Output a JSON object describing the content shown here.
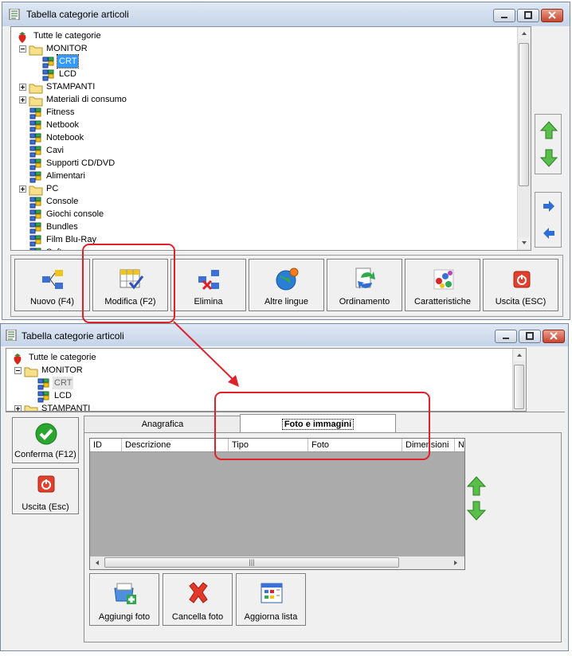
{
  "window1": {
    "title": "Tabella categorie articoli",
    "tree": [
      {
        "label": "Tutte le categorie",
        "icon": "strawberry-icon",
        "level": 0,
        "expander": ""
      },
      {
        "label": "MONITOR",
        "icon": "folder-icon",
        "level": 1,
        "expander": "-"
      },
      {
        "label": "CRT",
        "icon": "category-node-icon",
        "level": 2,
        "expander": "",
        "selected": true
      },
      {
        "label": "LCD",
        "icon": "category-node-icon",
        "level": 2,
        "expander": ""
      },
      {
        "label": "STAMPANTI",
        "icon": "folder-icon",
        "level": 1,
        "expander": "+"
      },
      {
        "label": "Materiali di consumo",
        "icon": "folder-icon",
        "level": 1,
        "expander": "+"
      },
      {
        "label": "Fitness",
        "icon": "category-node-icon",
        "level": 1,
        "expander": ""
      },
      {
        "label": "Netbook",
        "icon": "category-node-icon",
        "level": 1,
        "expander": ""
      },
      {
        "label": "Notebook",
        "icon": "category-node-icon",
        "level": 1,
        "expander": ""
      },
      {
        "label": "Cavi",
        "icon": "category-node-icon",
        "level": 1,
        "expander": ""
      },
      {
        "label": "Supporti CD/DVD",
        "icon": "category-node-icon",
        "level": 1,
        "expander": ""
      },
      {
        "label": "Alimentari",
        "icon": "category-node-icon",
        "level": 1,
        "expander": ""
      },
      {
        "label": "PC",
        "icon": "folder-icon",
        "level": 1,
        "expander": "+"
      },
      {
        "label": "Console",
        "icon": "category-node-icon",
        "level": 1,
        "expander": ""
      },
      {
        "label": "Giochi console",
        "icon": "category-node-icon",
        "level": 1,
        "expander": ""
      },
      {
        "label": "Bundles",
        "icon": "category-node-icon",
        "level": 1,
        "expander": ""
      },
      {
        "label": "Film Blu-Ray",
        "icon": "category-node-icon",
        "level": 1,
        "expander": ""
      },
      {
        "label": "Software",
        "icon": "category-node-icon",
        "level": 1,
        "expander": ""
      }
    ],
    "toolbar": [
      {
        "label": "Nuovo (F4)",
        "icon": "new-node-icon",
        "name": "nuovo-button"
      },
      {
        "label": "Modifica (F2)",
        "icon": "edit-grid-icon",
        "name": "modifica-button"
      },
      {
        "label": "Elimina",
        "icon": "delete-node-icon",
        "name": "elimina-button"
      },
      {
        "label": "Altre lingue",
        "icon": "globe-icon",
        "name": "altre-lingue-button"
      },
      {
        "label": "Ordinamento",
        "icon": "sort-icon",
        "name": "ordinamento-button"
      },
      {
        "label": "Caratteristiche",
        "icon": "features-icon",
        "name": "caratteristiche-button"
      },
      {
        "label": "Uscita (ESC)",
        "icon": "exit-icon",
        "name": "uscita-button"
      }
    ]
  },
  "window2": {
    "title": "Tabella categorie articoli",
    "tree": [
      {
        "label": "Tutte le categorie",
        "icon": "strawberry-icon",
        "level": 0,
        "expander": ""
      },
      {
        "label": "MONITOR",
        "icon": "folder-icon",
        "level": 1,
        "expander": "-"
      },
      {
        "label": "CRT",
        "icon": "category-node-icon",
        "level": 2,
        "expander": "",
        "selected": true
      },
      {
        "label": "LCD",
        "icon": "category-node-icon",
        "level": 2,
        "expander": ""
      },
      {
        "label": "STAMPANTI",
        "icon": "folder-icon",
        "level": 1,
        "expander": "+"
      }
    ],
    "confirm_label": "Conferma (F12)",
    "exit_label": "Uscita (Esc)",
    "tabs": [
      {
        "label": "Anagrafica",
        "active": false
      },
      {
        "label": "Foto e immagini",
        "active": true
      }
    ],
    "grid_columns": [
      "ID",
      "Descrizione",
      "Tipo",
      "Foto",
      "Dimensioni",
      "N"
    ],
    "actions": [
      {
        "label": "Aggiungi foto",
        "icon": "add-photo-icon",
        "name": "aggiungi-foto-button"
      },
      {
        "label": "Cancella foto",
        "icon": "delete-x-icon",
        "name": "cancella-foto-button"
      },
      {
        "label": "Aggiorna lista",
        "icon": "refresh-list-icon",
        "name": "aggiorna-lista-button"
      }
    ]
  },
  "colors": {
    "highlight": "#e0202a",
    "selection": "#3399ff",
    "grid_body": "#ababab"
  }
}
